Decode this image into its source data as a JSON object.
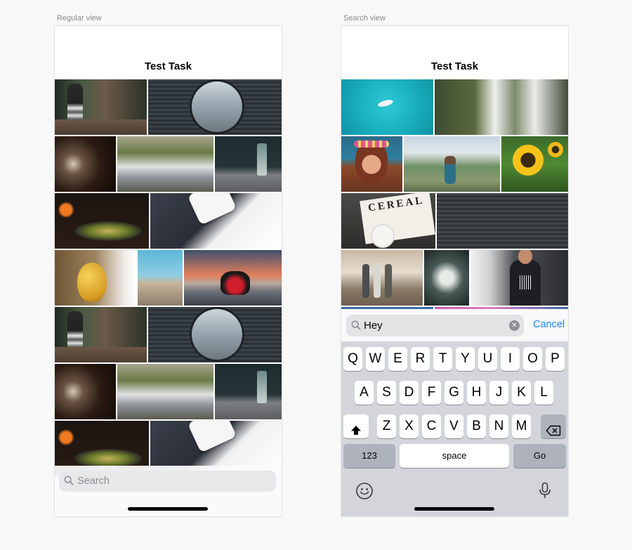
{
  "labels": {
    "regular": "Regular view",
    "search": "Search view"
  },
  "regular": {
    "nav_title": "Test Task",
    "search_placeholder": "Search"
  },
  "search": {
    "nav_title": "Test Task",
    "search_value": "Hey",
    "cancel_label": "Cancel"
  },
  "keyboard": {
    "row1": [
      "Q",
      "W",
      "E",
      "R",
      "T",
      "Y",
      "U",
      "I",
      "O",
      "P"
    ],
    "row2": [
      "A",
      "S",
      "D",
      "F",
      "G",
      "H",
      "J",
      "K",
      "L"
    ],
    "row3": [
      "Z",
      "X",
      "C",
      "V",
      "B",
      "N",
      "M"
    ],
    "numbers_label": "123",
    "space_label": "space",
    "go_label": "Go"
  },
  "icons": [
    "search-icon",
    "clear-icon",
    "shift-icon",
    "delete-icon",
    "emoji-icon",
    "microphone-icon"
  ],
  "colors": {
    "accent": "#1a84f7",
    "keyboard_bg": "#d3d5db"
  }
}
